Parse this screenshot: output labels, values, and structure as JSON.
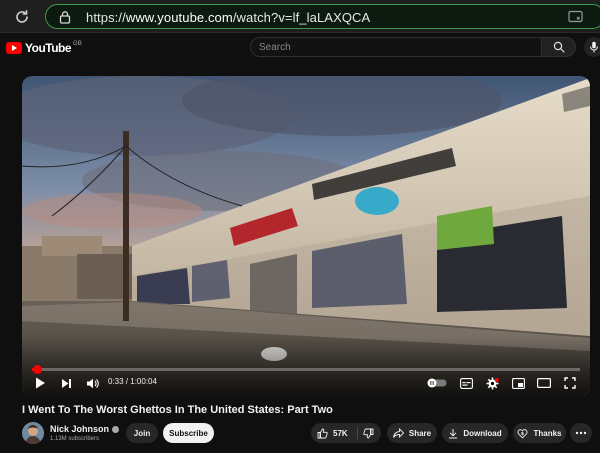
{
  "browser": {
    "url_prefix": "https://",
    "url_domain": "www.youtube.com",
    "url_path": "/watch?v=lf_laLAXQCA"
  },
  "header": {
    "logo_text": "YouTube",
    "logo_country": "GB",
    "search_placeholder": "Search"
  },
  "player": {
    "current_time": "0:33",
    "time_separator": " / ",
    "duration": "1:00:04",
    "progress_fraction": 0.0092
  },
  "video": {
    "title": "I Went To The Worst Ghettos In The United States: Part Two"
  },
  "channel": {
    "name": "Nick Johnson",
    "subscribers": "1.13M subscribers"
  },
  "actions": {
    "join": "Join",
    "subscribe": "Subscribe",
    "likes": "57K",
    "share": "Share",
    "download": "Download",
    "thanks": "Thanks"
  },
  "colors": {
    "accent": "#ff0000",
    "url_border": "#3d9a4a"
  },
  "icons": [
    "reload-icon",
    "lock-icon",
    "reader-icon",
    "search-icon",
    "mic-icon",
    "play-icon",
    "next-icon",
    "volume-icon",
    "autoplay-toggle-icon",
    "captions-icon",
    "settings-icon",
    "miniplayer-icon",
    "theater-icon",
    "fullscreen-icon",
    "like-icon",
    "dislike-icon",
    "share-icon",
    "download-icon",
    "thanks-icon",
    "more-icon",
    "verified-icon"
  ]
}
